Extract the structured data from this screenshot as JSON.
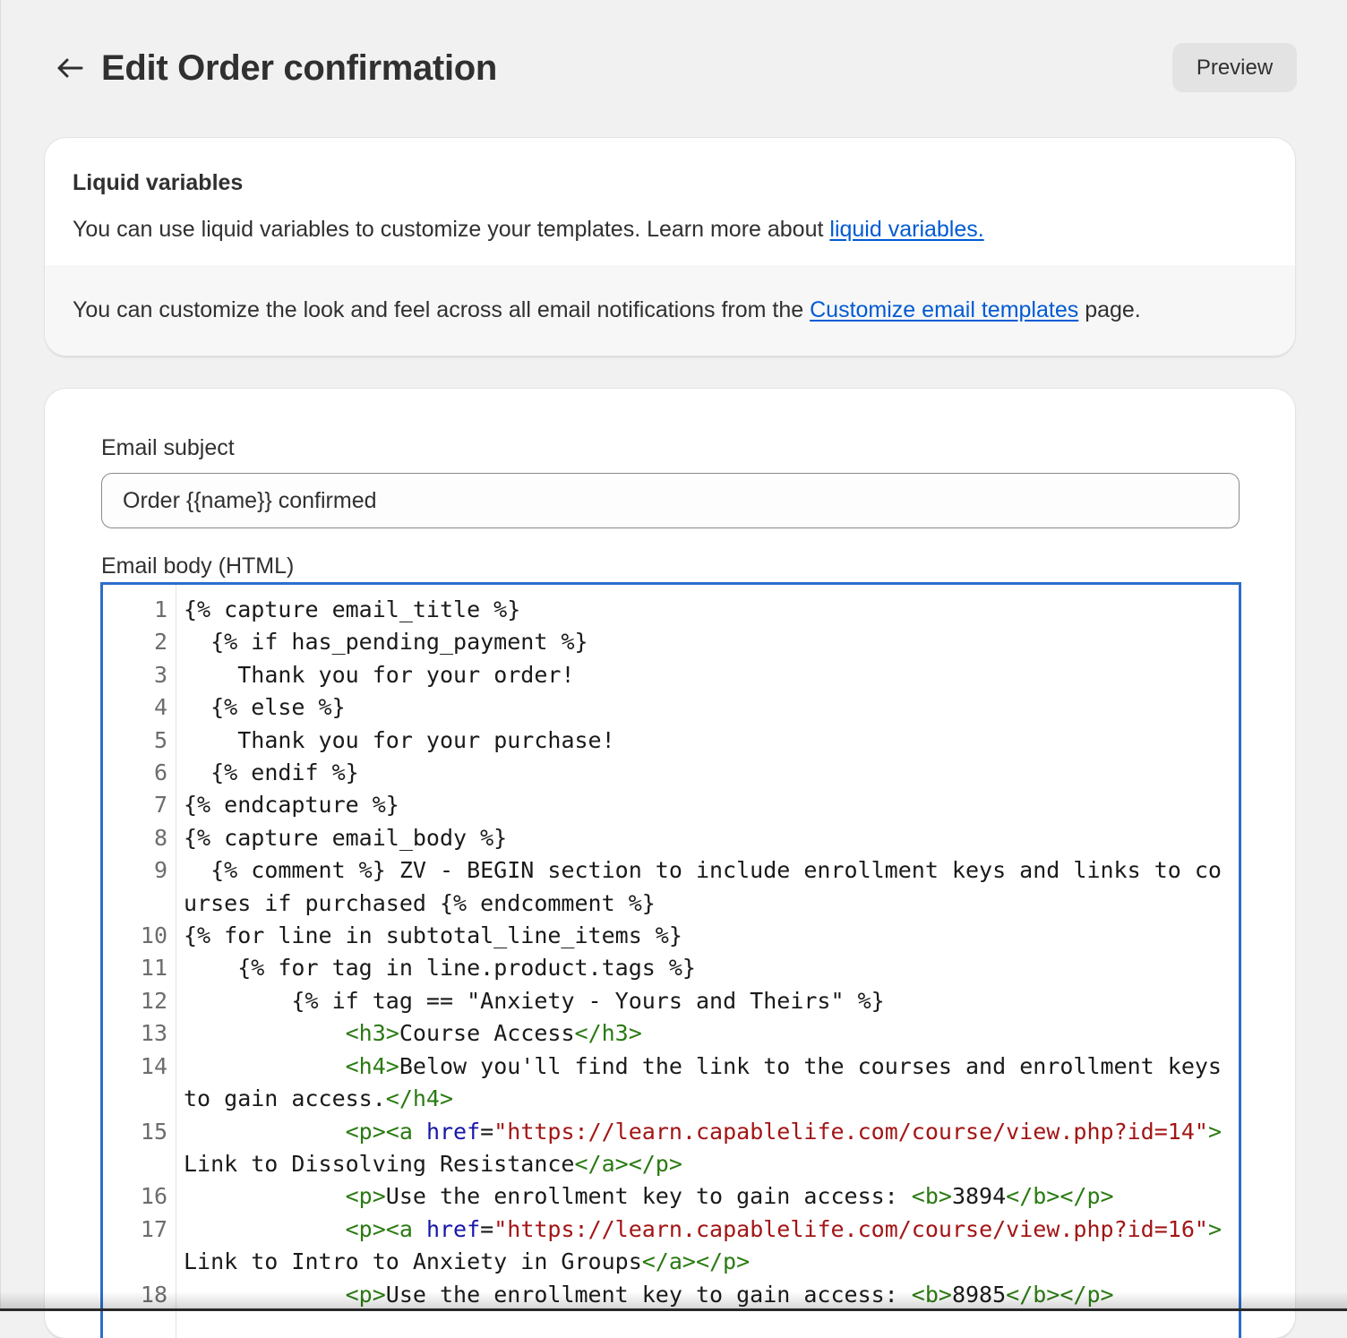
{
  "header": {
    "title": "Edit Order confirmation",
    "preview_label": "Preview"
  },
  "liquid_card": {
    "title": "Liquid variables",
    "text": "You can use liquid variables to customize your templates. Learn more about ",
    "link": "liquid variables.",
    "customize_text_before": "You can customize the look and feel across all email notifications from the ",
    "customize_link": "Customize email templates",
    "customize_text_after": " page."
  },
  "email": {
    "subject_label": "Email subject",
    "subject_value": "Order {{name}} confirmed",
    "body_label": "Email body (HTML)",
    "code_lines": [
      {
        "num": "1",
        "segments": [
          {
            "t": "p",
            "v": "{% capture email_title %}"
          }
        ]
      },
      {
        "num": "2",
        "segments": [
          {
            "t": "p",
            "v": "  {% if has_pending_payment %}"
          }
        ]
      },
      {
        "num": "3",
        "segments": [
          {
            "t": "p",
            "v": "    Thank you for your order!"
          }
        ]
      },
      {
        "num": "4",
        "segments": [
          {
            "t": "p",
            "v": "  {% else %}"
          }
        ]
      },
      {
        "num": "5",
        "segments": [
          {
            "t": "p",
            "v": "    Thank you for your purchase!"
          }
        ]
      },
      {
        "num": "6",
        "segments": [
          {
            "t": "p",
            "v": "  {% endif %}"
          }
        ]
      },
      {
        "num": "7",
        "segments": [
          {
            "t": "p",
            "v": "{% endcapture %}"
          }
        ]
      },
      {
        "num": "8",
        "segments": [
          {
            "t": "p",
            "v": "{% capture email_body %}"
          }
        ]
      },
      {
        "num": "9",
        "segments": [
          {
            "t": "p",
            "v": "  {% comment %} ZV - BEGIN section to include enrollment keys and links to courses if purchased {% endcomment %}"
          }
        ]
      },
      {
        "num": "10",
        "segments": [
          {
            "t": "p",
            "v": "{% for line in subtotal_line_items %}"
          }
        ]
      },
      {
        "num": "11",
        "segments": [
          {
            "t": "p",
            "v": "    {% for tag in line.product.tags %}"
          }
        ]
      },
      {
        "num": "12",
        "segments": [
          {
            "t": "p",
            "v": "        {% if tag == \"Anxiety - Yours and Theirs\" %}"
          }
        ]
      },
      {
        "num": "13",
        "segments": [
          {
            "t": "p",
            "v": "            "
          },
          {
            "t": "tag",
            "v": "<h3>"
          },
          {
            "t": "p",
            "v": "Course Access"
          },
          {
            "t": "tag",
            "v": "</h3>"
          }
        ]
      },
      {
        "num": "14",
        "segments": [
          {
            "t": "p",
            "v": "            "
          },
          {
            "t": "tag",
            "v": "<h4>"
          },
          {
            "t": "p",
            "v": "Below you'll find the link to the courses and enrollment keys to gain access."
          },
          {
            "t": "tag",
            "v": "</h4>"
          }
        ]
      },
      {
        "num": "15",
        "segments": [
          {
            "t": "p",
            "v": "            "
          },
          {
            "t": "tag",
            "v": "<p><a "
          },
          {
            "t": "attr",
            "v": "href"
          },
          {
            "t": "p",
            "v": "="
          },
          {
            "t": "str",
            "v": "\"https://learn.capablelife.com/course/view.php?id=14\""
          },
          {
            "t": "tag",
            "v": ">"
          },
          {
            "t": "p",
            "v": "Link to Dissolving Resistance"
          },
          {
            "t": "tag",
            "v": "</a></p>"
          }
        ]
      },
      {
        "num": "16",
        "segments": [
          {
            "t": "p",
            "v": "            "
          },
          {
            "t": "tag",
            "v": "<p>"
          },
          {
            "t": "p",
            "v": "Use the enrollment key to gain access: "
          },
          {
            "t": "tag",
            "v": "<b>"
          },
          {
            "t": "p",
            "v": "3894"
          },
          {
            "t": "tag",
            "v": "</b></p>"
          }
        ]
      },
      {
        "num": "17",
        "segments": [
          {
            "t": "p",
            "v": "            "
          },
          {
            "t": "tag",
            "v": "<p><a "
          },
          {
            "t": "attr",
            "v": "href"
          },
          {
            "t": "p",
            "v": "="
          },
          {
            "t": "str",
            "v": "\"https://learn.capablelife.com/course/view.php?id=16\""
          },
          {
            "t": "tag",
            "v": ">"
          },
          {
            "t": "p",
            "v": "Link to Intro to Anxiety in Groups"
          },
          {
            "t": "tag",
            "v": "</a></p>"
          }
        ]
      },
      {
        "num": "18",
        "segments": [
          {
            "t": "p",
            "v": "            "
          },
          {
            "t": "tag",
            "v": "<p>"
          },
          {
            "t": "p",
            "v": "Use the enrollment key to gain access: "
          },
          {
            "t": "tag",
            "v": "<b>"
          },
          {
            "t": "p",
            "v": "8985"
          },
          {
            "t": "tag",
            "v": "</b></p>"
          }
        ]
      }
    ]
  },
  "colors": {
    "accent_link": "#005bd3",
    "editor_focus": "#2c6ecb",
    "code_tag": "#2a7a12",
    "code_attr": "#1717a8",
    "code_string": "#a31515"
  },
  "icons": {
    "back": "arrow-left-icon"
  }
}
